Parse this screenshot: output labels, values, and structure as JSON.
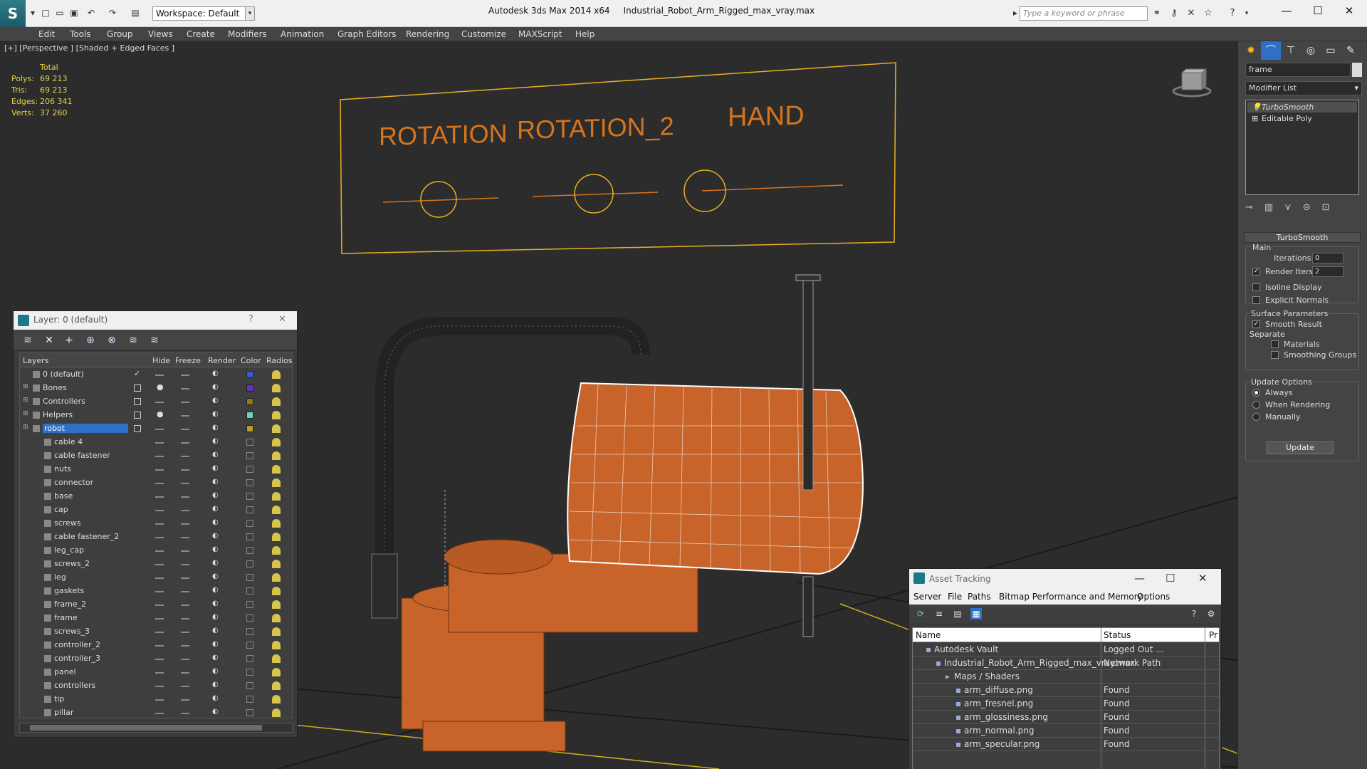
{
  "app": {
    "title": "Autodesk 3ds Max  2014 x64",
    "file": "Industrial_Robot_Arm_Rigged_max_vray.max",
    "workspace": "Workspace: Default",
    "search_placeholder": "Type a keyword or phrase"
  },
  "menu": [
    "Edit",
    "Tools",
    "Group",
    "Views",
    "Create",
    "Modifiers",
    "Animation",
    "Graph Editors",
    "Rendering",
    "Customize",
    "MAXScript",
    "Help"
  ],
  "viewport": {
    "label": "[+] [Perspective ] [Shaded + Edged Faces ]",
    "stats": {
      "header": "Total",
      "rows": [
        {
          "label": "Polys:",
          "value": "69 213"
        },
        {
          "label": "Tris:",
          "value": "69 213"
        },
        {
          "label": "Edges:",
          "value": "206 341"
        },
        {
          "label": "Verts:",
          "value": "37 260"
        }
      ]
    },
    "controls": {
      "rotation": "ROTATION",
      "rotation_2": "ROTATION_2",
      "hand": "HAND"
    },
    "colors": {
      "robot": "#c8642a",
      "wire": "#e8b020",
      "bg": "#2c2c2c"
    }
  },
  "layer_dialog": {
    "title": "Layer: 0 (default)",
    "help": "?",
    "close": "✕",
    "columns": {
      "layers": "Layers",
      "hide": "Hide",
      "freeze": "Freeze",
      "render": "Render",
      "color": "Color",
      "radiosity": "Radios"
    },
    "layers": [
      {
        "name": "0 (default)",
        "type": "layer",
        "color": "#3b5bd6",
        "current": true
      },
      {
        "name": "Bones",
        "type": "layer",
        "color": "#6a2cc2",
        "bulb": true
      },
      {
        "name": "Controllers",
        "type": "layer",
        "color": "#8a7a1a"
      },
      {
        "name": "Helpers",
        "type": "layer",
        "color": "#6ad6b0",
        "bulb": true
      },
      {
        "name": "robot",
        "type": "layer",
        "color": "#b8a020",
        "selected": true
      },
      {
        "name": "cable 4",
        "type": "object"
      },
      {
        "name": "cable fastener",
        "type": "object"
      },
      {
        "name": "nuts",
        "type": "object"
      },
      {
        "name": "connector",
        "type": "object"
      },
      {
        "name": "base",
        "type": "object"
      },
      {
        "name": "cap",
        "type": "object"
      },
      {
        "name": "screws",
        "type": "object"
      },
      {
        "name": "cable fastener_2",
        "type": "object"
      },
      {
        "name": "leg_cap",
        "type": "object"
      },
      {
        "name": "screws_2",
        "type": "object"
      },
      {
        "name": "leg",
        "type": "object"
      },
      {
        "name": "gaskets",
        "type": "object"
      },
      {
        "name": "frame_2",
        "type": "object"
      },
      {
        "name": "frame",
        "type": "object"
      },
      {
        "name": "screws_3",
        "type": "object"
      },
      {
        "name": "controller_2",
        "type": "object"
      },
      {
        "name": "controller_3",
        "type": "object"
      },
      {
        "name": "panel",
        "type": "object"
      },
      {
        "name": "controllers",
        "type": "object"
      },
      {
        "name": "tip",
        "type": "object"
      },
      {
        "name": "pillar",
        "type": "object"
      }
    ]
  },
  "command_panel": {
    "object_name": "frame",
    "modifier_list": "Modifier List",
    "stack": [
      "TurboSmooth",
      "Editable Poly"
    ],
    "rollout": "TurboSmooth",
    "main": "Main",
    "iterations_label": "Iterations:",
    "iterations": "0",
    "render_iters_label": "Render Iters:",
    "render_iters": "2",
    "isoline": "Isoline Display",
    "explicit": "Explicit Normals",
    "surface": "Surface Parameters",
    "smooth_result": "Smooth Result",
    "separate": "Separate",
    "materials": "Materials",
    "smoothing_groups": "Smoothing Groups",
    "update_options": "Update Options",
    "always": "Always",
    "when_rendering": "When Rendering",
    "manually": "Manually",
    "update": "Update"
  },
  "asset_tracking": {
    "title": "Asset Tracking",
    "menu": [
      "Server",
      "File",
      "Paths",
      "Bitmap Performance and Memory",
      "Options"
    ],
    "columns": {
      "name": "Name",
      "status": "Status",
      "pr": "Pr"
    },
    "rows": [
      {
        "name": "Autodesk Vault",
        "status": "Logged Out ...",
        "indent": 1
      },
      {
        "name": "Industrial_Robot_Arm_Rigged_max_vray.max",
        "status": "Network Path",
        "indent": 2
      },
      {
        "name": "Maps / Shaders",
        "status": "",
        "indent": 3
      },
      {
        "name": "arm_diffuse.png",
        "status": "Found",
        "indent": 4
      },
      {
        "name": "arm_fresnel.png",
        "status": "Found",
        "indent": 4
      },
      {
        "name": "arm_glossiness.png",
        "status": "Found",
        "indent": 4
      },
      {
        "name": "arm_normal.png",
        "status": "Found",
        "indent": 4
      },
      {
        "name": "arm_specular.png",
        "status": "Found",
        "indent": 4
      }
    ]
  }
}
